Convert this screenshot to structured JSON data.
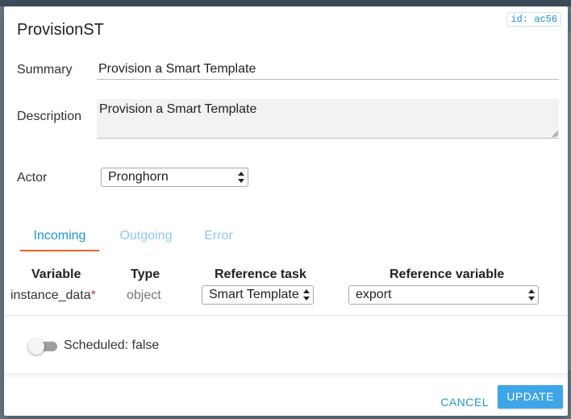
{
  "dialog": {
    "id_badge": "id: ac56",
    "title": "ProvisionST"
  },
  "form": {
    "summary_label": "Summary",
    "summary_value": "Provision a Smart Template",
    "description_label": "Description",
    "description_value": "Provision a Smart Template",
    "actor_label": "Actor",
    "actor_value": "Pronghorn"
  },
  "tabs": [
    {
      "label": "Incoming",
      "active": true
    },
    {
      "label": "Outgoing",
      "active": false
    },
    {
      "label": "Error",
      "active": false
    }
  ],
  "variables_table": {
    "headers": [
      "Variable",
      "Type",
      "Reference task",
      "Reference variable"
    ],
    "rows": [
      {
        "variable": "instance_data",
        "required": true,
        "type": "object",
        "reference_task": "Smart Template",
        "reference_variable": "export"
      }
    ]
  },
  "scheduled": {
    "label": "Scheduled: false",
    "value": false
  },
  "footer": {
    "cancel_label": "CANCEL",
    "update_label": "UPDATE"
  },
  "colors": {
    "accent": "#2196d3",
    "tab_underline": "#e8622a",
    "update_button": "#3ea6e6",
    "required_asterisk": "#d32f2f"
  }
}
